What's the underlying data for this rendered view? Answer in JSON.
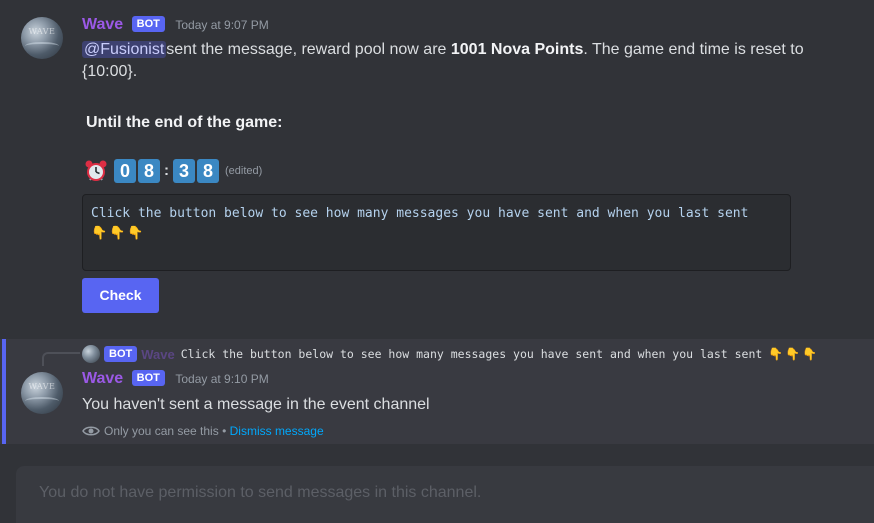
{
  "message1": {
    "author": "Wave",
    "bot_tag": "BOT",
    "timestamp": "Today at 9:07 PM",
    "mention": "@Fusionist",
    "text_part1": "sent the message,  reward pool now are ",
    "text_bold": "1001 Nova Points",
    "text_part2": ". The game end time is reset to {10:00}.",
    "until_label": "Until the end of the game:",
    "timer": {
      "d1": "0",
      "d2": "8",
      "d3": "3",
      "d4": "8",
      "colon": ":"
    },
    "edited": "(edited)",
    "code_line": "Click the button below to see how many messages you have sent and when you last sent",
    "code_hands": "👇👇👇",
    "button_label": "Check"
  },
  "reply": {
    "bot_tag": "BOT",
    "author": "Wave",
    "text": "Click the button below to see how many messages you have sent and when you last sent",
    "hands": "👇👇👇"
  },
  "message2": {
    "author": "Wave",
    "bot_tag": "BOT",
    "timestamp": "Today at 9:10 PM",
    "text": "You haven't sent a message in the event channel",
    "only_you": "Only you can see this",
    "separator": " • ",
    "dismiss": "Dismiss message"
  },
  "input": {
    "placeholder": "You do not have permission to send messages in this channel."
  },
  "colors": {
    "background": "#313338",
    "username": "#9b59e6",
    "blurple": "#5865f2",
    "link": "#00a8fc",
    "timer_digit": "#3b88c3"
  },
  "icons": {
    "alarm": "alarm-clock-icon",
    "eye": "eye-icon",
    "hands": "pointing-down-icon"
  }
}
